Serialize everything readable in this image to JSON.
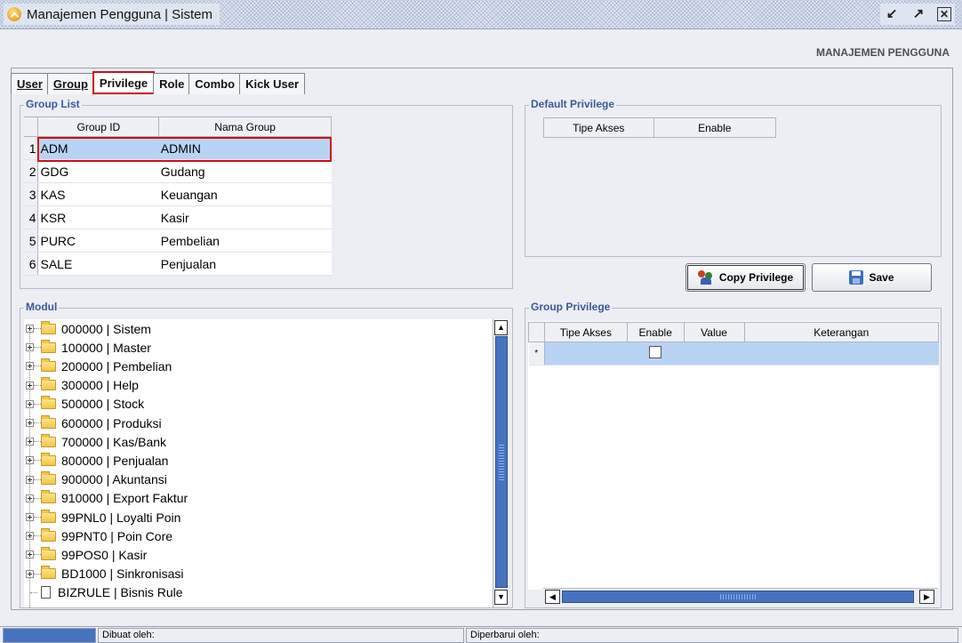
{
  "window": {
    "title": "Manajemen Pengguna | Sistem",
    "restore_symbol": "ⁿ⬀",
    "maximize_symbol": "⬀",
    "close_symbol": "✕"
  },
  "header": {
    "section_title": "MANAJEMEN PENGGUNA"
  },
  "tabs": [
    {
      "label": "User",
      "underline": "U",
      "active": false
    },
    {
      "label": "Group",
      "underline": "G",
      "active": false
    },
    {
      "label": "Privilege",
      "active": true
    },
    {
      "label": "Role",
      "active": false
    },
    {
      "label": "Combo",
      "active": false
    },
    {
      "label": "Kick User",
      "active": false
    }
  ],
  "group_list": {
    "legend": "Group List",
    "columns": [
      "Group ID",
      "Nama Group"
    ],
    "rows": [
      {
        "num": "1",
        "id": "ADM",
        "name": "ADMIN"
      },
      {
        "num": "2",
        "id": "GDG",
        "name": "Gudang"
      },
      {
        "num": "3",
        "id": "KAS",
        "name": "Keuangan"
      },
      {
        "num": "4",
        "id": "KSR",
        "name": "Kasir"
      },
      {
        "num": "5",
        "id": "PURC",
        "name": "Pembelian"
      },
      {
        "num": "6",
        "id": "SALE",
        "name": "Penjualan"
      }
    ]
  },
  "default_privilege": {
    "legend": "Default Privilege",
    "columns": [
      "Tipe Akses",
      "Enable"
    ]
  },
  "buttons": {
    "copy_privilege": "Copy Privilege",
    "save": "Save"
  },
  "modul": {
    "legend": "Modul",
    "items": [
      {
        "label": "000000 | Sistem",
        "type": "folder"
      },
      {
        "label": "100000 | Master",
        "type": "folder"
      },
      {
        "label": "200000 | Pembelian",
        "type": "folder"
      },
      {
        "label": "300000 | Help",
        "type": "folder"
      },
      {
        "label": "500000 | Stock",
        "type": "folder"
      },
      {
        "label": "600000 | Produksi",
        "type": "folder"
      },
      {
        "label": "700000 | Kas/Bank",
        "type": "folder"
      },
      {
        "label": "800000 | Penjualan",
        "type": "folder"
      },
      {
        "label": "900000 | Akuntansi",
        "type": "folder"
      },
      {
        "label": "910000 | Export Faktur",
        "type": "folder"
      },
      {
        "label": "99PNL0 | Loyalti Poin",
        "type": "folder"
      },
      {
        "label": "99PNT0 | Poin Core",
        "type": "folder"
      },
      {
        "label": "99POS0 | Kasir",
        "type": "folder"
      },
      {
        "label": "BD1000 | Sinkronisasi",
        "type": "folder"
      },
      {
        "label": "BIZRULE | Bisnis Rule",
        "type": "file"
      }
    ]
  },
  "group_privilege": {
    "legend": "Group Privilege",
    "columns": [
      "Tipe Akses",
      "Enable",
      "Value",
      "Keterangan"
    ],
    "new_row_marker": "*"
  },
  "status": {
    "created_by": "Dibuat oleh:",
    "updated_by": "Diperbarui oleh:"
  }
}
